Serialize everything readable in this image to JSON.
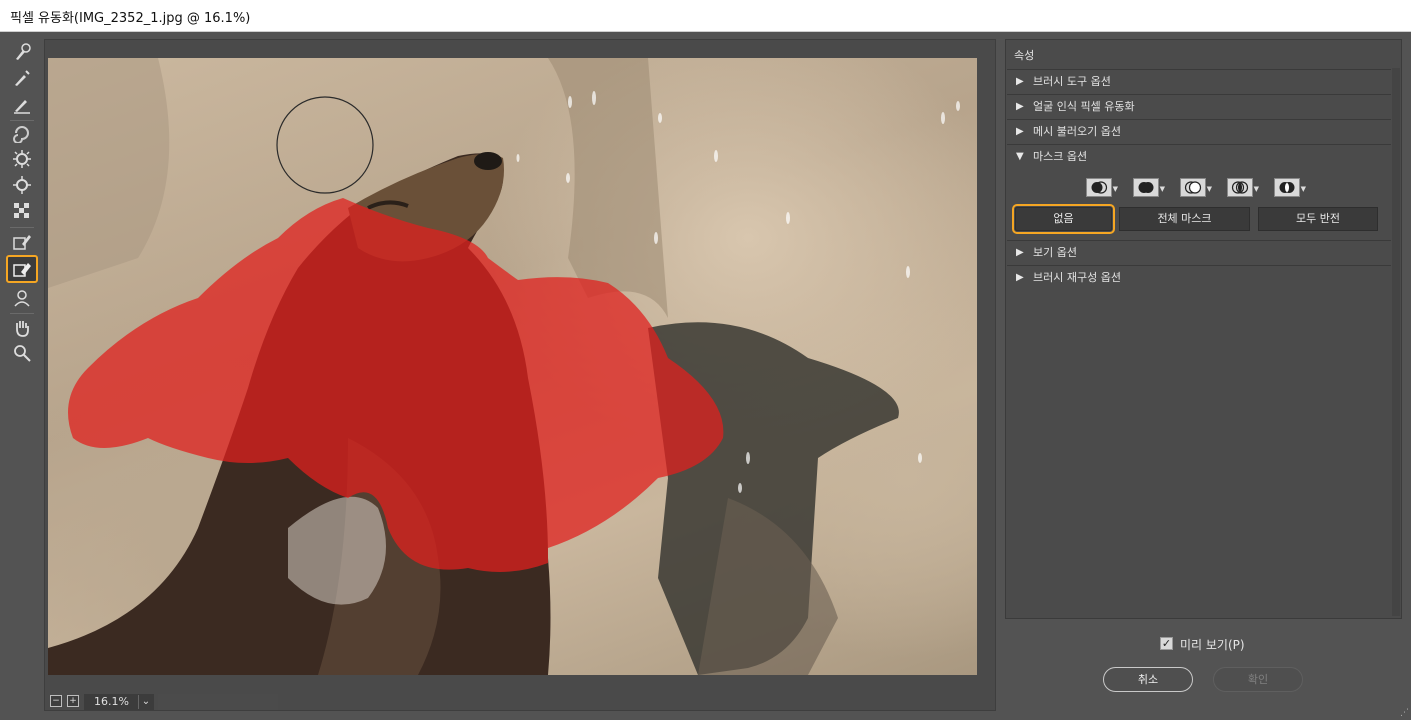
{
  "window": {
    "title": "픽셀 유동화(IMG_2352_1.jpg @ 16.1%)"
  },
  "toolbar": {
    "tools": [
      {
        "icon": "forward-warp-icon",
        "active": false
      },
      {
        "icon": "reconstruct-brush-icon",
        "active": false
      },
      {
        "icon": "smooth-brush-icon",
        "active": false
      },
      {
        "icon": "twirl-icon",
        "active": false
      },
      {
        "icon": "pucker-icon",
        "active": false
      },
      {
        "icon": "bloat-icon",
        "active": false
      },
      {
        "icon": "push-left-icon",
        "active": false
      },
      {
        "icon": "freeze-mask-icon",
        "active": false
      },
      {
        "icon": "thaw-mask-icon",
        "active": true
      },
      {
        "icon": "face-tool-icon",
        "active": false
      },
      {
        "icon": "hand-icon",
        "active": false
      },
      {
        "icon": "zoom-icon",
        "active": false
      }
    ]
  },
  "zoom": {
    "value": "16.1%"
  },
  "properties": {
    "title": "속성",
    "sections": {
      "brush_tool": "브러시 도구 옵션",
      "face_aware": "얼굴 인식 픽셀 유동화",
      "load_mesh": "메시 불러오기 옵션",
      "mask": "마스크 옵션",
      "view": "보기 옵션",
      "brush_reconstruct": "브러시 재구성 옵션"
    },
    "mask_buttons": {
      "none": "없음",
      "mask_all": "전체 마스크",
      "invert_all": "모두 반전"
    }
  },
  "footer": {
    "preview_label": "미리 보기(P)",
    "preview_checked": true,
    "cancel": "취소",
    "ok": "확인"
  },
  "colors": {
    "accent": "#f5a623",
    "mask_overlay": "#e0201e"
  }
}
